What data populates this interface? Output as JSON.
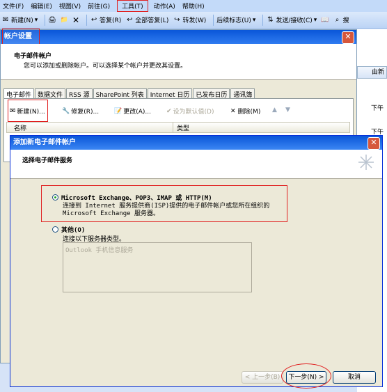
{
  "menu": [
    "文件(F)",
    "编辑(E)",
    "视图(V)",
    "前往(G)",
    "工具(T)",
    "动作(A)",
    "帮助(H)"
  ],
  "toolbar": {
    "new": "新建(N)",
    "reply": "答复(R)",
    "reply_all": "全部答复(L)",
    "forward": "转发(W)",
    "followup": "后续标志(U)",
    "send_receive": "发送/接收(C)",
    "search": "搜"
  },
  "right_strip": {
    "col_header": "由新",
    "row1": "下午",
    "row2": "下午"
  },
  "account_settings": {
    "title": "帐户设置",
    "heading": "电子邮件帐户",
    "description": "您可以添加或删除帐户。可以选择某个帐户并更改其设置。",
    "tabs": [
      "电子邮件",
      "数据文件",
      "RSS 源",
      "SharePoint 列表",
      "Internet 日历",
      "已发布日历",
      "通讯簿"
    ],
    "actions": {
      "new": "新建(N)...",
      "repair": "修复(R)...",
      "change": "更改(A)...",
      "set_default": "设为默认值(D)",
      "remove": "删除(M)"
    },
    "columns": {
      "name": "名称",
      "type": "类型"
    }
  },
  "dialog": {
    "title": "添加新电子邮件帐户",
    "heading": "选择电子邮件服务",
    "option1": {
      "label": "Microsoft Exchange、POP3、IMAP 或 HTTP(M)",
      "desc": "连接到 Internet 服务提供商(ISP)提供的电子邮件帐户或您所在组织的 Microsoft Exchange 服务器。"
    },
    "option2": {
      "label": "其他(O)",
      "desc": "连接以下服务器类型。",
      "list_item": "Outlook 手机信息服务"
    },
    "buttons": {
      "back": "< 上一步(B)",
      "next": "下一步(N) >",
      "cancel": "取消"
    }
  }
}
